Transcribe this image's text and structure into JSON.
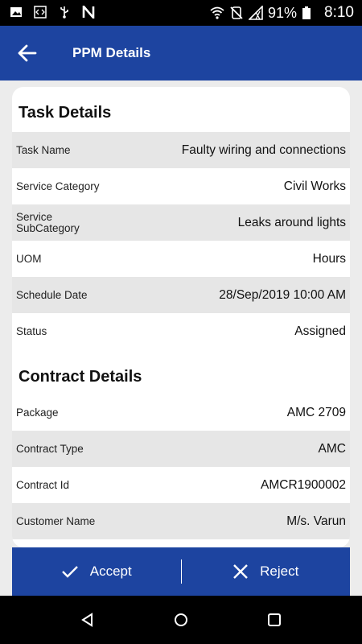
{
  "status_bar": {
    "battery": "91%",
    "time": "8:10",
    "icons": [
      "image-icon",
      "code-icon",
      "usb-icon",
      "n-icon",
      "wifi-icon",
      "mute-icon",
      "signal-icon",
      "battery-icon"
    ]
  },
  "app_bar": {
    "title": "PPM Details",
    "back_icon": "arrow-left-icon"
  },
  "task_details": {
    "title": "Task Details",
    "rows": [
      {
        "label": "Task Name",
        "value": "Faulty wiring and connections"
      },
      {
        "label": "Service Category",
        "value": "Civil Works"
      },
      {
        "label": "Service SubCategory",
        "value": "Leaks around lights"
      },
      {
        "label": "UOM",
        "value": "Hours"
      },
      {
        "label": "Schedule Date",
        "value": "28/Sep/2019 10:00 AM"
      },
      {
        "label": "Status",
        "value": "Assigned"
      }
    ]
  },
  "contract_details": {
    "title": "Contract Details",
    "rows": [
      {
        "label": "Package",
        "value": "AMC 2709"
      },
      {
        "label": "Contract Type",
        "value": "AMC"
      },
      {
        "label": "Contract Id",
        "value": "AMCR1900002"
      },
      {
        "label": "Customer Name",
        "value": "M/s. Varun"
      }
    ]
  },
  "actions": {
    "accept": "Accept",
    "reject": "Reject"
  },
  "colors": {
    "primary": "#1d44a0",
    "row_alt": "#e6e6e6"
  }
}
